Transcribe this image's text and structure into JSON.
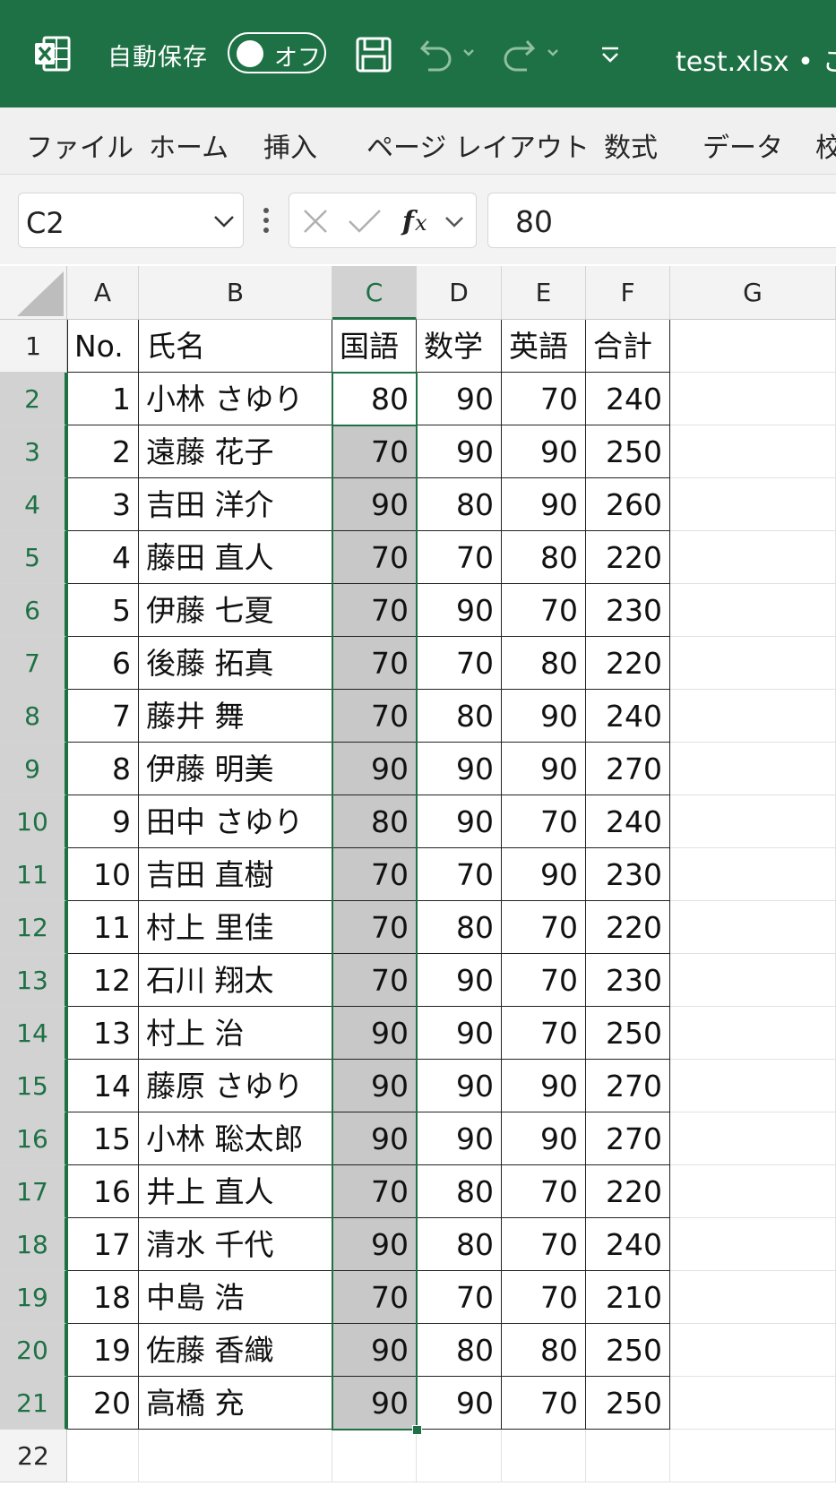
{
  "titlebar": {
    "autosave_label": "自動保存",
    "toggle_label": "オフ",
    "filename": "test.xlsx • こ",
    "color": "#1e7145"
  },
  "ribbon": {
    "tabs": [
      "ファイル",
      "ホーム",
      "挿入",
      "ページ レイアウト",
      "数式",
      "データ",
      "校"
    ]
  },
  "formula_bar": {
    "name_box": "C2",
    "value": "80"
  },
  "sheet": {
    "columns": [
      "A",
      "B",
      "C",
      "D",
      "E",
      "F",
      "G"
    ],
    "selected_column": "C",
    "active_cell": "C2",
    "header_row": [
      "No.",
      "氏名",
      "国語",
      "数学",
      "英語",
      "合計"
    ],
    "rows": [
      [
        1,
        "小林 さゆり",
        80,
        90,
        70,
        240
      ],
      [
        2,
        "遠藤 花子",
        70,
        90,
        90,
        250
      ],
      [
        3,
        "吉田 洋介",
        90,
        80,
        90,
        260
      ],
      [
        4,
        "藤田 直人",
        70,
        70,
        80,
        220
      ],
      [
        5,
        "伊藤 七夏",
        70,
        90,
        70,
        230
      ],
      [
        6,
        "後藤 拓真",
        70,
        70,
        80,
        220
      ],
      [
        7,
        "藤井 舞",
        70,
        80,
        90,
        240
      ],
      [
        8,
        "伊藤 明美",
        90,
        90,
        90,
        270
      ],
      [
        9,
        "田中 さゆり",
        80,
        90,
        70,
        240
      ],
      [
        10,
        "吉田 直樹",
        70,
        70,
        90,
        230
      ],
      [
        11,
        "村上 里佳",
        70,
        80,
        70,
        220
      ],
      [
        12,
        "石川 翔太",
        70,
        90,
        70,
        230
      ],
      [
        13,
        "村上 治",
        90,
        90,
        70,
        250
      ],
      [
        14,
        "藤原 さゆり",
        90,
        90,
        90,
        270
      ],
      [
        15,
        "小林 聡太郎",
        90,
        90,
        90,
        270
      ],
      [
        16,
        "井上 直人",
        70,
        80,
        70,
        220
      ],
      [
        17,
        "清水 千代",
        90,
        80,
        70,
        240
      ],
      [
        18,
        "中島 浩",
        70,
        70,
        70,
        210
      ],
      [
        19,
        "佐藤 香織",
        90,
        80,
        80,
        250
      ],
      [
        20,
        "高橋 充",
        90,
        90,
        70,
        250
      ]
    ],
    "row_numbers": [
      "1",
      "2",
      "3",
      "4",
      "5",
      "6",
      "7",
      "8",
      "9",
      "10",
      "11",
      "12",
      "13",
      "14",
      "15",
      "16",
      "17",
      "18",
      "19",
      "20",
      "21",
      "22"
    ]
  }
}
